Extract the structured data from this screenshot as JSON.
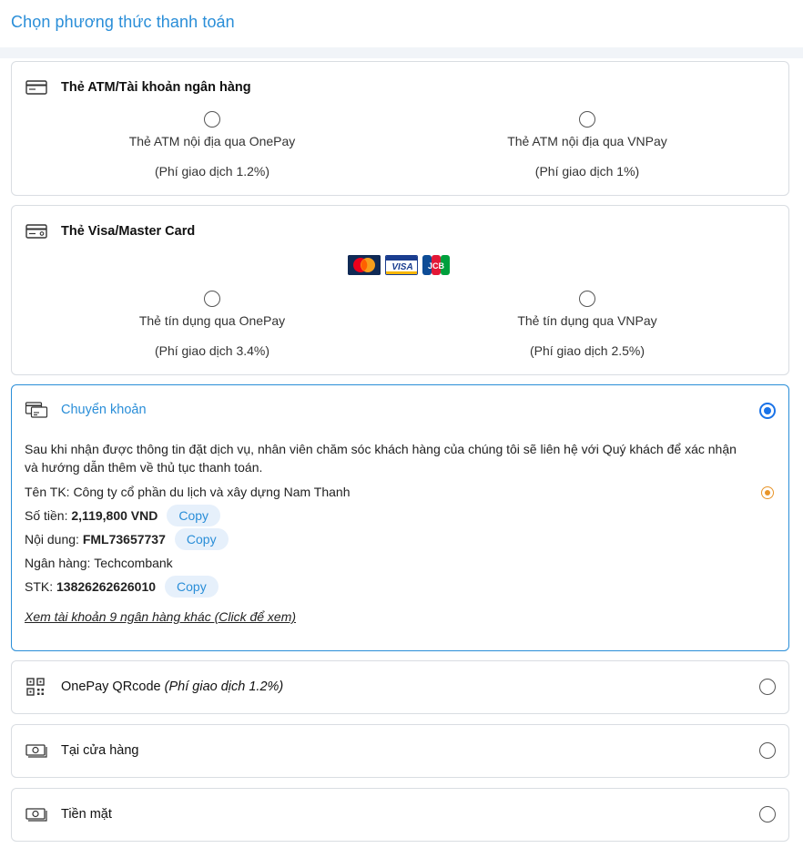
{
  "page_title": "Chọn phương thức thanh toán",
  "atm": {
    "title": "Thẻ ATM/Tài khoản ngân hàng",
    "options": [
      {
        "label": "Thẻ ATM nội địa qua OnePay",
        "fee": "(Phí giao dịch 1.2%)"
      },
      {
        "label": "Thẻ ATM nội địa qua VNPay",
        "fee": "(Phí giao dịch 1%)"
      }
    ]
  },
  "visa": {
    "title": "Thẻ Visa/Master Card",
    "brands": {
      "visa": "VISA",
      "jcb": "JCB"
    },
    "options": [
      {
        "label": "Thẻ tín dụng qua OnePay",
        "fee": "(Phí giao dịch 3.4%)"
      },
      {
        "label": "Thẻ tín dụng qua VNPay",
        "fee": "(Phí giao dịch 2.5%)"
      }
    ]
  },
  "transfer": {
    "title": "Chuyển khoản",
    "description": "Sau khi nhận được thông tin đặt dịch vụ, nhân viên chăm sóc khách hàng của chúng tôi sẽ liên hệ với Quý khách để xác nhận và hướng dẫn thêm về thủ tục thanh toán.",
    "account_name_label": "Tên TK: ",
    "account_name": "Công ty cổ phần du lịch và xây dựng Nam Thanh",
    "amount_label": "Số tiền: ",
    "amount": "2,119,800 VND",
    "content_label": "Nội dung: ",
    "content": "FML73657737",
    "bank_label": "Ngân hàng: ",
    "bank": "Techcombank",
    "stk_label": "STK: ",
    "stk": "13826262626010",
    "copy_label": "Copy",
    "more_link": "Xem tài khoản 9 ngân hàng khác (Click để xem)"
  },
  "qr": {
    "title": "OnePay QRcode ",
    "fee": "(Phí giao dịch 1.2%)"
  },
  "store": {
    "title": "Tại cửa hàng"
  },
  "cash": {
    "title": "Tiền mặt"
  }
}
